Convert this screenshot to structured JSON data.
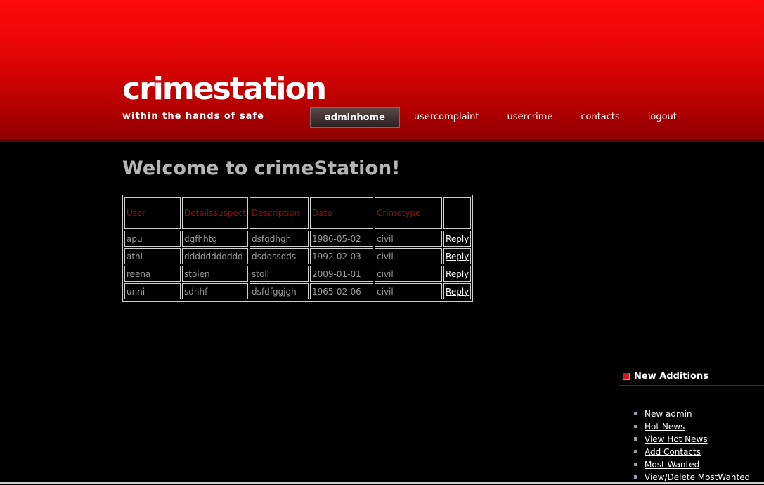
{
  "site": {
    "title": "crimestation",
    "tagline": "within the hands of safe"
  },
  "nav": {
    "items": [
      {
        "label": "adminhome",
        "active": true
      },
      {
        "label": "usercomplaint",
        "active": false
      },
      {
        "label": "usercrime",
        "active": false
      },
      {
        "label": "contacts",
        "active": false
      },
      {
        "label": "logout",
        "active": false
      }
    ]
  },
  "main": {
    "heading": "Welcome to crimeStation!",
    "table": {
      "headers": [
        "User",
        "Detailssuspect",
        "Description",
        "Date",
        "Crimetype",
        ""
      ],
      "rows": [
        {
          "user": "apu",
          "suspect": "dgfhhtg",
          "description": "dsfgdhgh",
          "date": "1986-05-02",
          "crimetype": "civil",
          "action": "Reply"
        },
        {
          "user": "athi",
          "suspect": "ddddddddddd",
          "description": "dsddssdds",
          "date": "1992-02-03",
          "crimetype": "civil",
          "action": "Reply"
        },
        {
          "user": "reena",
          "suspect": "stolen",
          "description": "stoll",
          "date": "2009-01-01",
          "crimetype": "civil",
          "action": "Reply"
        },
        {
          "user": "unni",
          "suspect": "sdhhf",
          "description": "dsfdfggjgh",
          "date": "1965-02-06",
          "crimetype": "civil",
          "action": "Reply"
        }
      ]
    }
  },
  "sidebar": {
    "heading": "New Additions",
    "icon": "red-square-bullet-icon",
    "links": [
      {
        "label": "New admin"
      },
      {
        "label": "Hot News"
      },
      {
        "label": "View Hot News"
      },
      {
        "label": "Add Contacts"
      },
      {
        "label": "Most Wanted"
      },
      {
        "label": "View/Delete MostWanted"
      }
    ]
  },
  "colors": {
    "header_top": "#ff0a0a",
    "header_bottom": "#8e0000",
    "heading_text": "#b5b5b5",
    "table_header_text": "#8b1010",
    "table_text": "#9c9c9c"
  }
}
